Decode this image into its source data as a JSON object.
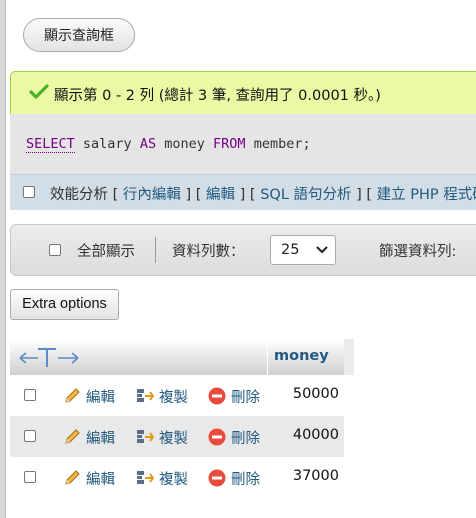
{
  "show_query_button": "顯示查詢框",
  "success": {
    "message": "顯示第 0 - 2 列 (總計 3 筆, 查詢用了 0.0001 秒。)"
  },
  "sql": {
    "kw_select": "SELECT",
    "col": "salary",
    "kw_as": "AS",
    "alias": "money",
    "kw_from": "FROM",
    "table": "member;"
  },
  "tools": {
    "profiling": "效能分析",
    "br_open": "[",
    "br_mid": "] [",
    "inline_edit": "行內編輯",
    "edit": "編輯",
    "explain": "SQL 語句分析",
    "create_php": "建立 PHP 程式碼"
  },
  "nav": {
    "show_all": "全部顯示",
    "rows_label": "資料列數：",
    "rows_value": "25",
    "filter_label": "篩選資料列:"
  },
  "extra_options": "Extra options",
  "table": {
    "column": "money",
    "rows": [
      {
        "edit": "編輯",
        "copy": "複製",
        "delete": "刪除",
        "value": "50000"
      },
      {
        "edit": "編輯",
        "copy": "複製",
        "delete": "刪除",
        "value": "40000"
      },
      {
        "edit": "編輯",
        "copy": "複製",
        "delete": "刪除",
        "value": "37000"
      }
    ]
  },
  "colors": {
    "link": "#235a81",
    "success_bg": "#ebf8a4",
    "success_border": "#a2d246",
    "sql_keyword": "#770088",
    "delete_red": "#e74c3c"
  },
  "icons": {
    "success": "check-icon",
    "edit": "pencil-icon",
    "copy": "copy-icon",
    "delete": "delete-icon",
    "column_arrows": "column-arrows-icon"
  }
}
